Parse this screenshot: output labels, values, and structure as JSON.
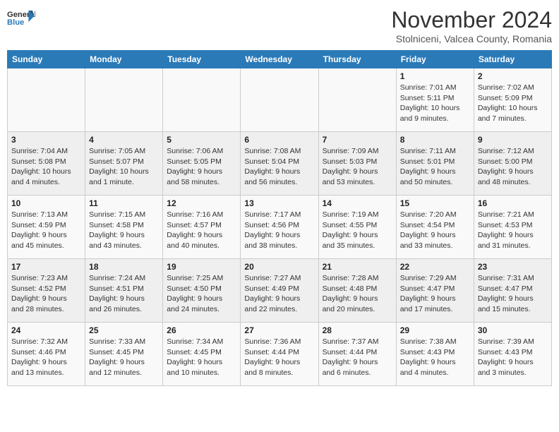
{
  "logo": {
    "general": "General",
    "blue": "Blue"
  },
  "title": {
    "month_year": "November 2024",
    "location": "Stolniceni, Valcea County, Romania"
  },
  "headers": [
    "Sunday",
    "Monday",
    "Tuesday",
    "Wednesday",
    "Thursday",
    "Friday",
    "Saturday"
  ],
  "weeks": [
    [
      {
        "day": "",
        "info": ""
      },
      {
        "day": "",
        "info": ""
      },
      {
        "day": "",
        "info": ""
      },
      {
        "day": "",
        "info": ""
      },
      {
        "day": "",
        "info": ""
      },
      {
        "day": "1",
        "info": "Sunrise: 7:01 AM\nSunset: 5:11 PM\nDaylight: 10 hours and 9 minutes."
      },
      {
        "day": "2",
        "info": "Sunrise: 7:02 AM\nSunset: 5:09 PM\nDaylight: 10 hours and 7 minutes."
      }
    ],
    [
      {
        "day": "3",
        "info": "Sunrise: 7:04 AM\nSunset: 5:08 PM\nDaylight: 10 hours and 4 minutes."
      },
      {
        "day": "4",
        "info": "Sunrise: 7:05 AM\nSunset: 5:07 PM\nDaylight: 10 hours and 1 minute."
      },
      {
        "day": "5",
        "info": "Sunrise: 7:06 AM\nSunset: 5:05 PM\nDaylight: 9 hours and 58 minutes."
      },
      {
        "day": "6",
        "info": "Sunrise: 7:08 AM\nSunset: 5:04 PM\nDaylight: 9 hours and 56 minutes."
      },
      {
        "day": "7",
        "info": "Sunrise: 7:09 AM\nSunset: 5:03 PM\nDaylight: 9 hours and 53 minutes."
      },
      {
        "day": "8",
        "info": "Sunrise: 7:11 AM\nSunset: 5:01 PM\nDaylight: 9 hours and 50 minutes."
      },
      {
        "day": "9",
        "info": "Sunrise: 7:12 AM\nSunset: 5:00 PM\nDaylight: 9 hours and 48 minutes."
      }
    ],
    [
      {
        "day": "10",
        "info": "Sunrise: 7:13 AM\nSunset: 4:59 PM\nDaylight: 9 hours and 45 minutes."
      },
      {
        "day": "11",
        "info": "Sunrise: 7:15 AM\nSunset: 4:58 PM\nDaylight: 9 hours and 43 minutes."
      },
      {
        "day": "12",
        "info": "Sunrise: 7:16 AM\nSunset: 4:57 PM\nDaylight: 9 hours and 40 minutes."
      },
      {
        "day": "13",
        "info": "Sunrise: 7:17 AM\nSunset: 4:56 PM\nDaylight: 9 hours and 38 minutes."
      },
      {
        "day": "14",
        "info": "Sunrise: 7:19 AM\nSunset: 4:55 PM\nDaylight: 9 hours and 35 minutes."
      },
      {
        "day": "15",
        "info": "Sunrise: 7:20 AM\nSunset: 4:54 PM\nDaylight: 9 hours and 33 minutes."
      },
      {
        "day": "16",
        "info": "Sunrise: 7:21 AM\nSunset: 4:53 PM\nDaylight: 9 hours and 31 minutes."
      }
    ],
    [
      {
        "day": "17",
        "info": "Sunrise: 7:23 AM\nSunset: 4:52 PM\nDaylight: 9 hours and 28 minutes."
      },
      {
        "day": "18",
        "info": "Sunrise: 7:24 AM\nSunset: 4:51 PM\nDaylight: 9 hours and 26 minutes."
      },
      {
        "day": "19",
        "info": "Sunrise: 7:25 AM\nSunset: 4:50 PM\nDaylight: 9 hours and 24 minutes."
      },
      {
        "day": "20",
        "info": "Sunrise: 7:27 AM\nSunset: 4:49 PM\nDaylight: 9 hours and 22 minutes."
      },
      {
        "day": "21",
        "info": "Sunrise: 7:28 AM\nSunset: 4:48 PM\nDaylight: 9 hours and 20 minutes."
      },
      {
        "day": "22",
        "info": "Sunrise: 7:29 AM\nSunset: 4:47 PM\nDaylight: 9 hours and 17 minutes."
      },
      {
        "day": "23",
        "info": "Sunrise: 7:31 AM\nSunset: 4:47 PM\nDaylight: 9 hours and 15 minutes."
      }
    ],
    [
      {
        "day": "24",
        "info": "Sunrise: 7:32 AM\nSunset: 4:46 PM\nDaylight: 9 hours and 13 minutes."
      },
      {
        "day": "25",
        "info": "Sunrise: 7:33 AM\nSunset: 4:45 PM\nDaylight: 9 hours and 12 minutes."
      },
      {
        "day": "26",
        "info": "Sunrise: 7:34 AM\nSunset: 4:45 PM\nDaylight: 9 hours and 10 minutes."
      },
      {
        "day": "27",
        "info": "Sunrise: 7:36 AM\nSunset: 4:44 PM\nDaylight: 9 hours and 8 minutes."
      },
      {
        "day": "28",
        "info": "Sunrise: 7:37 AM\nSunset: 4:44 PM\nDaylight: 9 hours and 6 minutes."
      },
      {
        "day": "29",
        "info": "Sunrise: 7:38 AM\nSunset: 4:43 PM\nDaylight: 9 hours and 4 minutes."
      },
      {
        "day": "30",
        "info": "Sunrise: 7:39 AM\nSunset: 4:43 PM\nDaylight: 9 hours and 3 minutes."
      }
    ]
  ]
}
